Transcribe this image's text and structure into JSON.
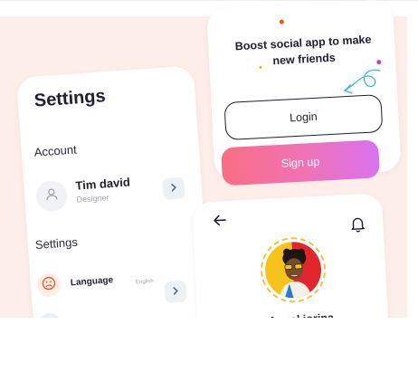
{
  "settings": {
    "title": "Settings",
    "account_section": "Account",
    "user": {
      "name": "Tim david",
      "role": "Designer"
    },
    "settings_section": "Settings",
    "language": {
      "label": "Language",
      "value": "English"
    },
    "icons": [
      "user-icon",
      "chevron-right-icon",
      "sad-face-icon",
      "wifi-icon"
    ]
  },
  "onboarding": {
    "headline": "Boost social app to make new friends",
    "login_label": "Login",
    "signup_label": "Sign up",
    "signup_gradient": [
      "#fa6e83",
      "#ef72b8",
      "#d971f0"
    ]
  },
  "profile": {
    "name": "Angel jorina",
    "icons": [
      "back-arrow-icon",
      "bell-icon"
    ]
  },
  "colors": {
    "background": "#fdeeea",
    "text_dark": "#1f1f2e",
    "accent_orange": "#e9561e",
    "accent_purple": "#c03ad6",
    "accent_yellow": "#f0c23a"
  }
}
